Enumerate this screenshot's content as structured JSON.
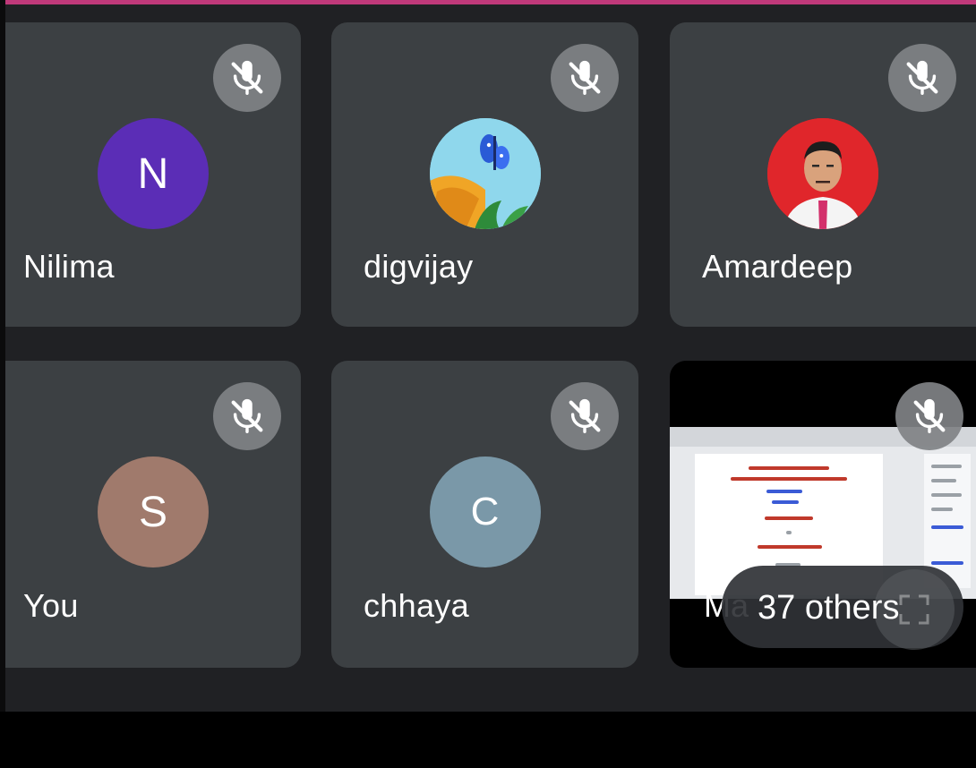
{
  "participants": [
    {
      "name": "Nilima",
      "initial": "N",
      "avatar_color": "#5b2db6",
      "muted": true
    },
    {
      "name": "digvijay",
      "initial": "",
      "avatar_color": "#7fd0e8",
      "muted": true
    },
    {
      "name": "Amardeep",
      "initial": "",
      "avatar_color": "#e0262b",
      "muted": true
    },
    {
      "name": "You",
      "initial": "S",
      "avatar_color": "#a07a6c",
      "muted": true
    },
    {
      "name": "chhaya",
      "initial": "C",
      "avatar_color": "#7a98a8",
      "muted": true
    },
    {
      "name": "Ma",
      "initial": "",
      "avatar_color": "#000000",
      "muted": true
    }
  ],
  "others": {
    "label": "37 others"
  },
  "icons": {
    "mute": "mic-off-icon",
    "expand": "expand-icon"
  }
}
